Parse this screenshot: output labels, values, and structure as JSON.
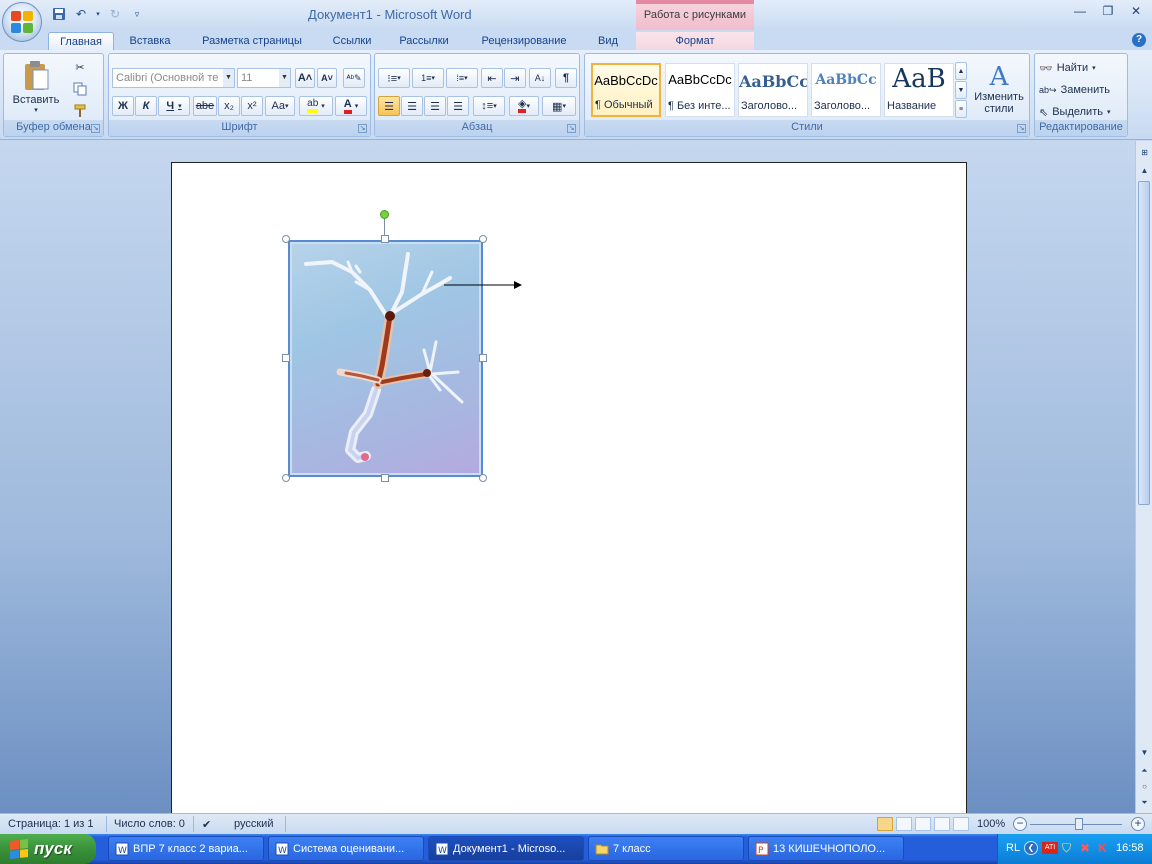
{
  "window": {
    "doc_title": "Документ1 - Microsoft Word",
    "context_tab_header": "Работа с рисунками"
  },
  "tabs": [
    {
      "label": "Главная"
    },
    {
      "label": "Вставка"
    },
    {
      "label": "Разметка страницы"
    },
    {
      "label": "Ссылки"
    },
    {
      "label": "Рассылки"
    },
    {
      "label": "Рецензирование"
    },
    {
      "label": "Вид"
    },
    {
      "label": "Формат"
    }
  ],
  "clipboard": {
    "paste_label": "Вставить",
    "group_label": "Буфер обмена"
  },
  "font": {
    "font_name": "Calibri (Основной те",
    "font_size": "11",
    "bold": "Ж",
    "italic": "К",
    "underline": "Ч",
    "strike": "abe",
    "subscript": "x₂",
    "superscript": "x²",
    "change_case": "Aa",
    "grow": "A˄",
    "shrink": "A˅",
    "group_label": "Шрифт"
  },
  "paragraph": {
    "group_label": "Абзац",
    "show_marks": "¶"
  },
  "styles": {
    "group_label": "Стили",
    "items": [
      {
        "sample": "AaBbCcDc",
        "name": "¶ Обычный"
      },
      {
        "sample": "AaBbCcDc",
        "name": "¶ Без инте..."
      },
      {
        "sample": "AaBbCc",
        "name": "Заголово..."
      },
      {
        "sample": "AaBbCc",
        "name": "Заголово..."
      },
      {
        "sample": "AaB",
        "name": "Название"
      }
    ],
    "change_styles_line1": "Изменить",
    "change_styles_line2": "стили"
  },
  "editing": {
    "find": "Найти",
    "replace": "Заменить",
    "select": "Выделить",
    "group_label": "Редактирование"
  },
  "statusbar": {
    "page": "Страница: 1 из 1",
    "words": "Число слов: 0",
    "language": "русский",
    "zoom": "100%"
  },
  "taskbar": {
    "start_label": "пуск",
    "tasks": [
      {
        "label": "ВПР 7 класс 2 вариа..."
      },
      {
        "label": "Система оценивани..."
      },
      {
        "label": "Документ1 - Microso..."
      },
      {
        "label": "7 класс"
      },
      {
        "label": "13  КИШЕЧНОПОЛО..."
      }
    ],
    "lang": "RL",
    "time": "16:58"
  },
  "colors": {
    "ribbon_bg": "#d5e3f5",
    "context_tab": "#f0bccc",
    "taskbar_blue": "#245edb",
    "start_green": "#3a923a",
    "selected_style_border": "#f0b43c"
  }
}
